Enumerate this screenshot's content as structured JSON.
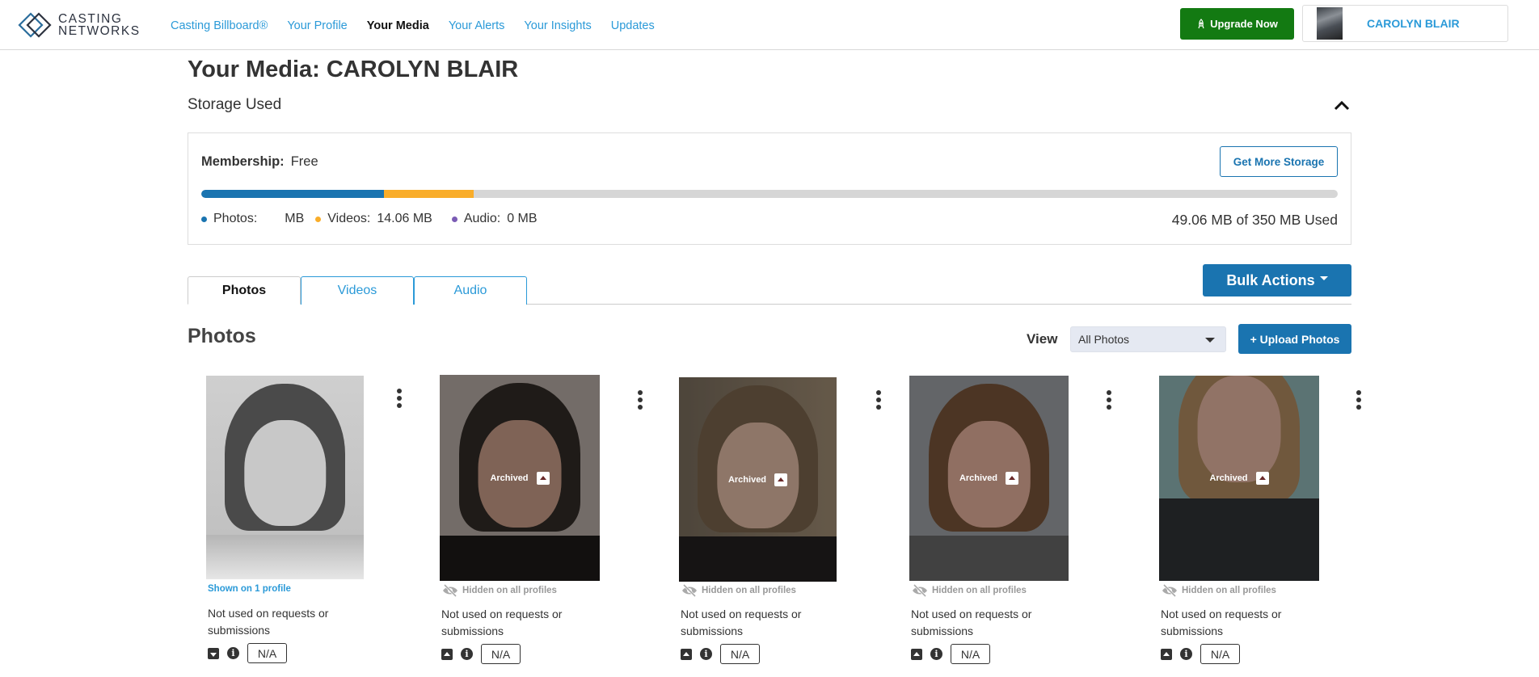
{
  "header": {
    "logo_line1": "CASTING",
    "logo_line2": "NETWORKS",
    "nav": [
      {
        "label": "Casting Billboard®",
        "active": false
      },
      {
        "label": "Your Profile",
        "active": false
      },
      {
        "label": "Your Media",
        "active": true
      },
      {
        "label": "Your Alerts",
        "active": false
      },
      {
        "label": "Your Insights",
        "active": false
      },
      {
        "label": "Updates",
        "active": false
      }
    ],
    "upgrade_label": "Upgrade Now",
    "user_name": "CAROLYN BLAIR"
  },
  "page": {
    "title": "Your Media: CAROLYN BLAIR",
    "storage_title": "Storage Used"
  },
  "storage": {
    "membership_label": "Membership:",
    "membership_value": "Free",
    "get_more_label": "Get More Storage",
    "photos_label": "Photos:",
    "photos_value": "MB",
    "videos_label": "Videos:",
    "videos_value": "14.06 MB",
    "audio_label": "Audio:",
    "audio_value": "0 MB",
    "total_used": "49.06 MB of 350 MB Used",
    "photos_fraction": 0.161,
    "videos_fraction": 0.079,
    "colors": {
      "photos": "#1a74b0",
      "videos": "#f9ad2a",
      "audio": "#7b5cb5",
      "empty": "#d6d6d6"
    }
  },
  "tabs": [
    {
      "label": "Photos",
      "active": true
    },
    {
      "label": "Videos",
      "active": false
    },
    {
      "label": "Audio",
      "active": false
    }
  ],
  "bulk_actions_label": "Bulk Actions",
  "photos_section": {
    "title": "Photos",
    "view_label": "View",
    "view_selected": "All Photos",
    "upload_label": "+ Upload Photos"
  },
  "photos": [
    {
      "archived": false,
      "archived_label": "",
      "visibility": "Shown on 1 profile",
      "visibility_state": "shown",
      "usage": "Not used on requests or submissions",
      "na": "N/A"
    },
    {
      "archived": true,
      "archived_label": "Archived",
      "visibility": "Hidden on all profiles",
      "visibility_state": "hidden",
      "usage": "Not used on requests or submissions",
      "na": "N/A"
    },
    {
      "archived": true,
      "archived_label": "Archived",
      "visibility": "Hidden on all profiles",
      "visibility_state": "hidden",
      "usage": "Not used on requests or submissions",
      "na": "N/A"
    },
    {
      "archived": true,
      "archived_label": "Archived",
      "visibility": "Hidden on all profiles",
      "visibility_state": "hidden",
      "usage": "Not used on requests or submissions",
      "na": "N/A"
    },
    {
      "archived": true,
      "archived_label": "Archived",
      "visibility": "Hidden on all profiles",
      "visibility_state": "hidden",
      "usage": "Not used on requests or submissions",
      "na": "N/A"
    }
  ]
}
